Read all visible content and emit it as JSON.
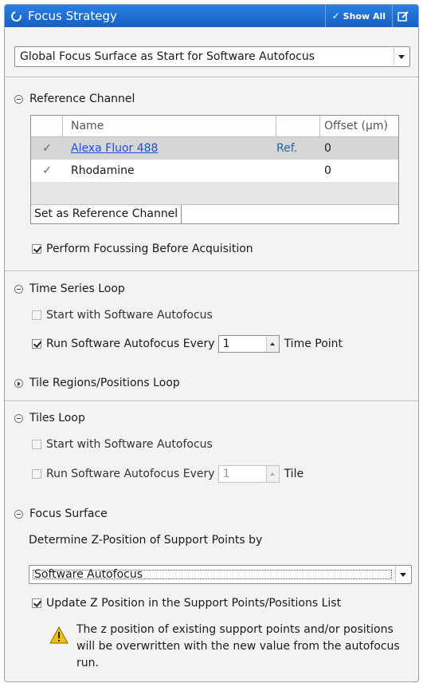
{
  "header": {
    "title": "Focus Strategy",
    "show_all_label": "Show All"
  },
  "strategy": {
    "selected": "Global Focus Surface as Start for Software Autofocus"
  },
  "reference_channel": {
    "section_label": "Reference Channel",
    "columns": {
      "name": "Name",
      "offset": "Offset (µm)"
    },
    "rows": [
      {
        "check": "✓",
        "name": "Alexa Fluor 488",
        "ref": "Ref.",
        "offset": "0"
      },
      {
        "check": "✓",
        "name": "Rhodamine",
        "ref": "",
        "offset": "0"
      }
    ],
    "set_button": "Set as Reference Channel",
    "perform_focusing": "Perform Focussing Before Acquisition"
  },
  "time_series": {
    "section_label": "Time Series Loop",
    "start_label": "Start with Software Autofocus",
    "run_label": "Run Software Autofocus Every",
    "run_value": "1",
    "run_unit": "Time Point"
  },
  "tile_regions": {
    "section_label": "Tile Regions/Positions Loop"
  },
  "tiles_loop": {
    "section_label": "Tiles Loop",
    "start_label": "Start with Software Autofocus",
    "run_label": "Run Software Autofocus Every",
    "run_value": "1",
    "run_unit": "Tile"
  },
  "focus_surface": {
    "section_label": "Focus Surface",
    "determine_label": "Determine Z-Position of Support Points by",
    "method_selected": "Software Autofocus",
    "update_label": "Update Z Position in the Support Points/Positions List",
    "warning_text": "The z position of existing support points and/or positions will be overwritten with the new value from the autofocus run."
  },
  "colors": {
    "titlebar": "#1f6fd6",
    "link": "#1a4fd6",
    "warning": "#f2c200"
  }
}
